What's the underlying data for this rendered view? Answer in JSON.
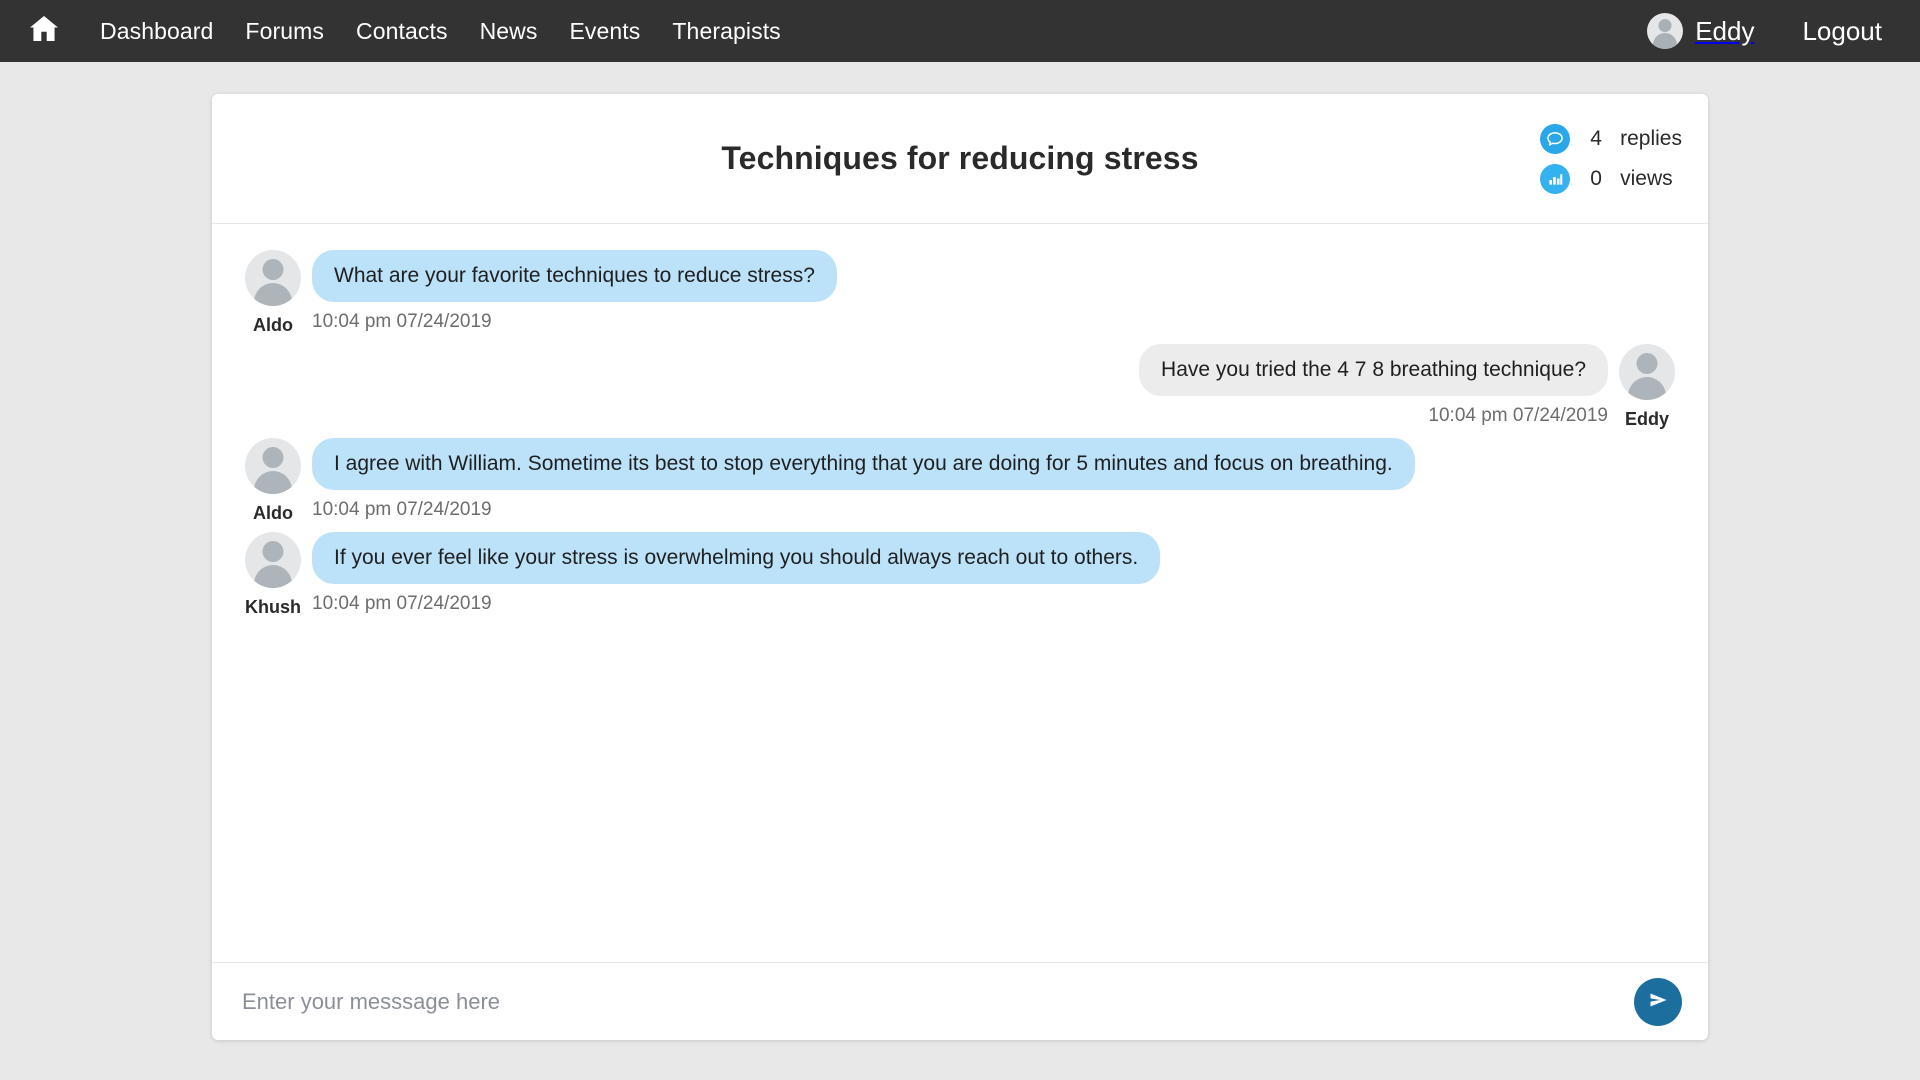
{
  "navbar": {
    "home_icon": "home-icon",
    "links": [
      {
        "label": "Dashboard"
      },
      {
        "label": "Forums"
      },
      {
        "label": "Contacts"
      },
      {
        "label": "News"
      },
      {
        "label": "Events"
      },
      {
        "label": "Therapists"
      }
    ],
    "user_name": "Eddy",
    "logout_label": "Logout",
    "background_color": "#333333",
    "text_color": "#ffffff"
  },
  "thread": {
    "title": "Techniques for reducing stress",
    "stats": [
      {
        "icon": "speech-bubble-icon",
        "count": "4",
        "label": "replies",
        "color": "#29a7e8"
      },
      {
        "icon": "bar-chart-icon",
        "count": "0",
        "label": "views",
        "color": "#34b1ef"
      }
    ]
  },
  "messages": [
    {
      "author": "Aldo",
      "text": "What are your favorite techniques to reduce stress?",
      "time": "10:04 pm 07/24/2019",
      "side": "left",
      "bubble_color": "#bce2fa"
    },
    {
      "author": "Eddy",
      "text": "Have you tried the 4 7 8 breathing technique?",
      "time": "10:04 pm 07/24/2019",
      "side": "right",
      "bubble_color": "#ececec"
    },
    {
      "author": "Aldo",
      "text": "I agree with William. Sometime its best to stop everything that you are doing for 5 minutes and focus on breathing.",
      "time": "10:04 pm 07/24/2019",
      "side": "left",
      "bubble_color": "#bce2fa"
    },
    {
      "author": "Khush",
      "text": "If you ever feel like your stress is overwhelming you should always reach out to others.",
      "time": "10:04 pm 07/24/2019",
      "side": "left",
      "bubble_color": "#bce2fa"
    }
  ],
  "composer": {
    "placeholder": "Enter your messsage here",
    "value": "",
    "send_icon": "send-icon",
    "send_color": "#1b6e9e"
  },
  "page": {
    "background_color": "#e8e8e8",
    "card_background": "#ffffff"
  }
}
